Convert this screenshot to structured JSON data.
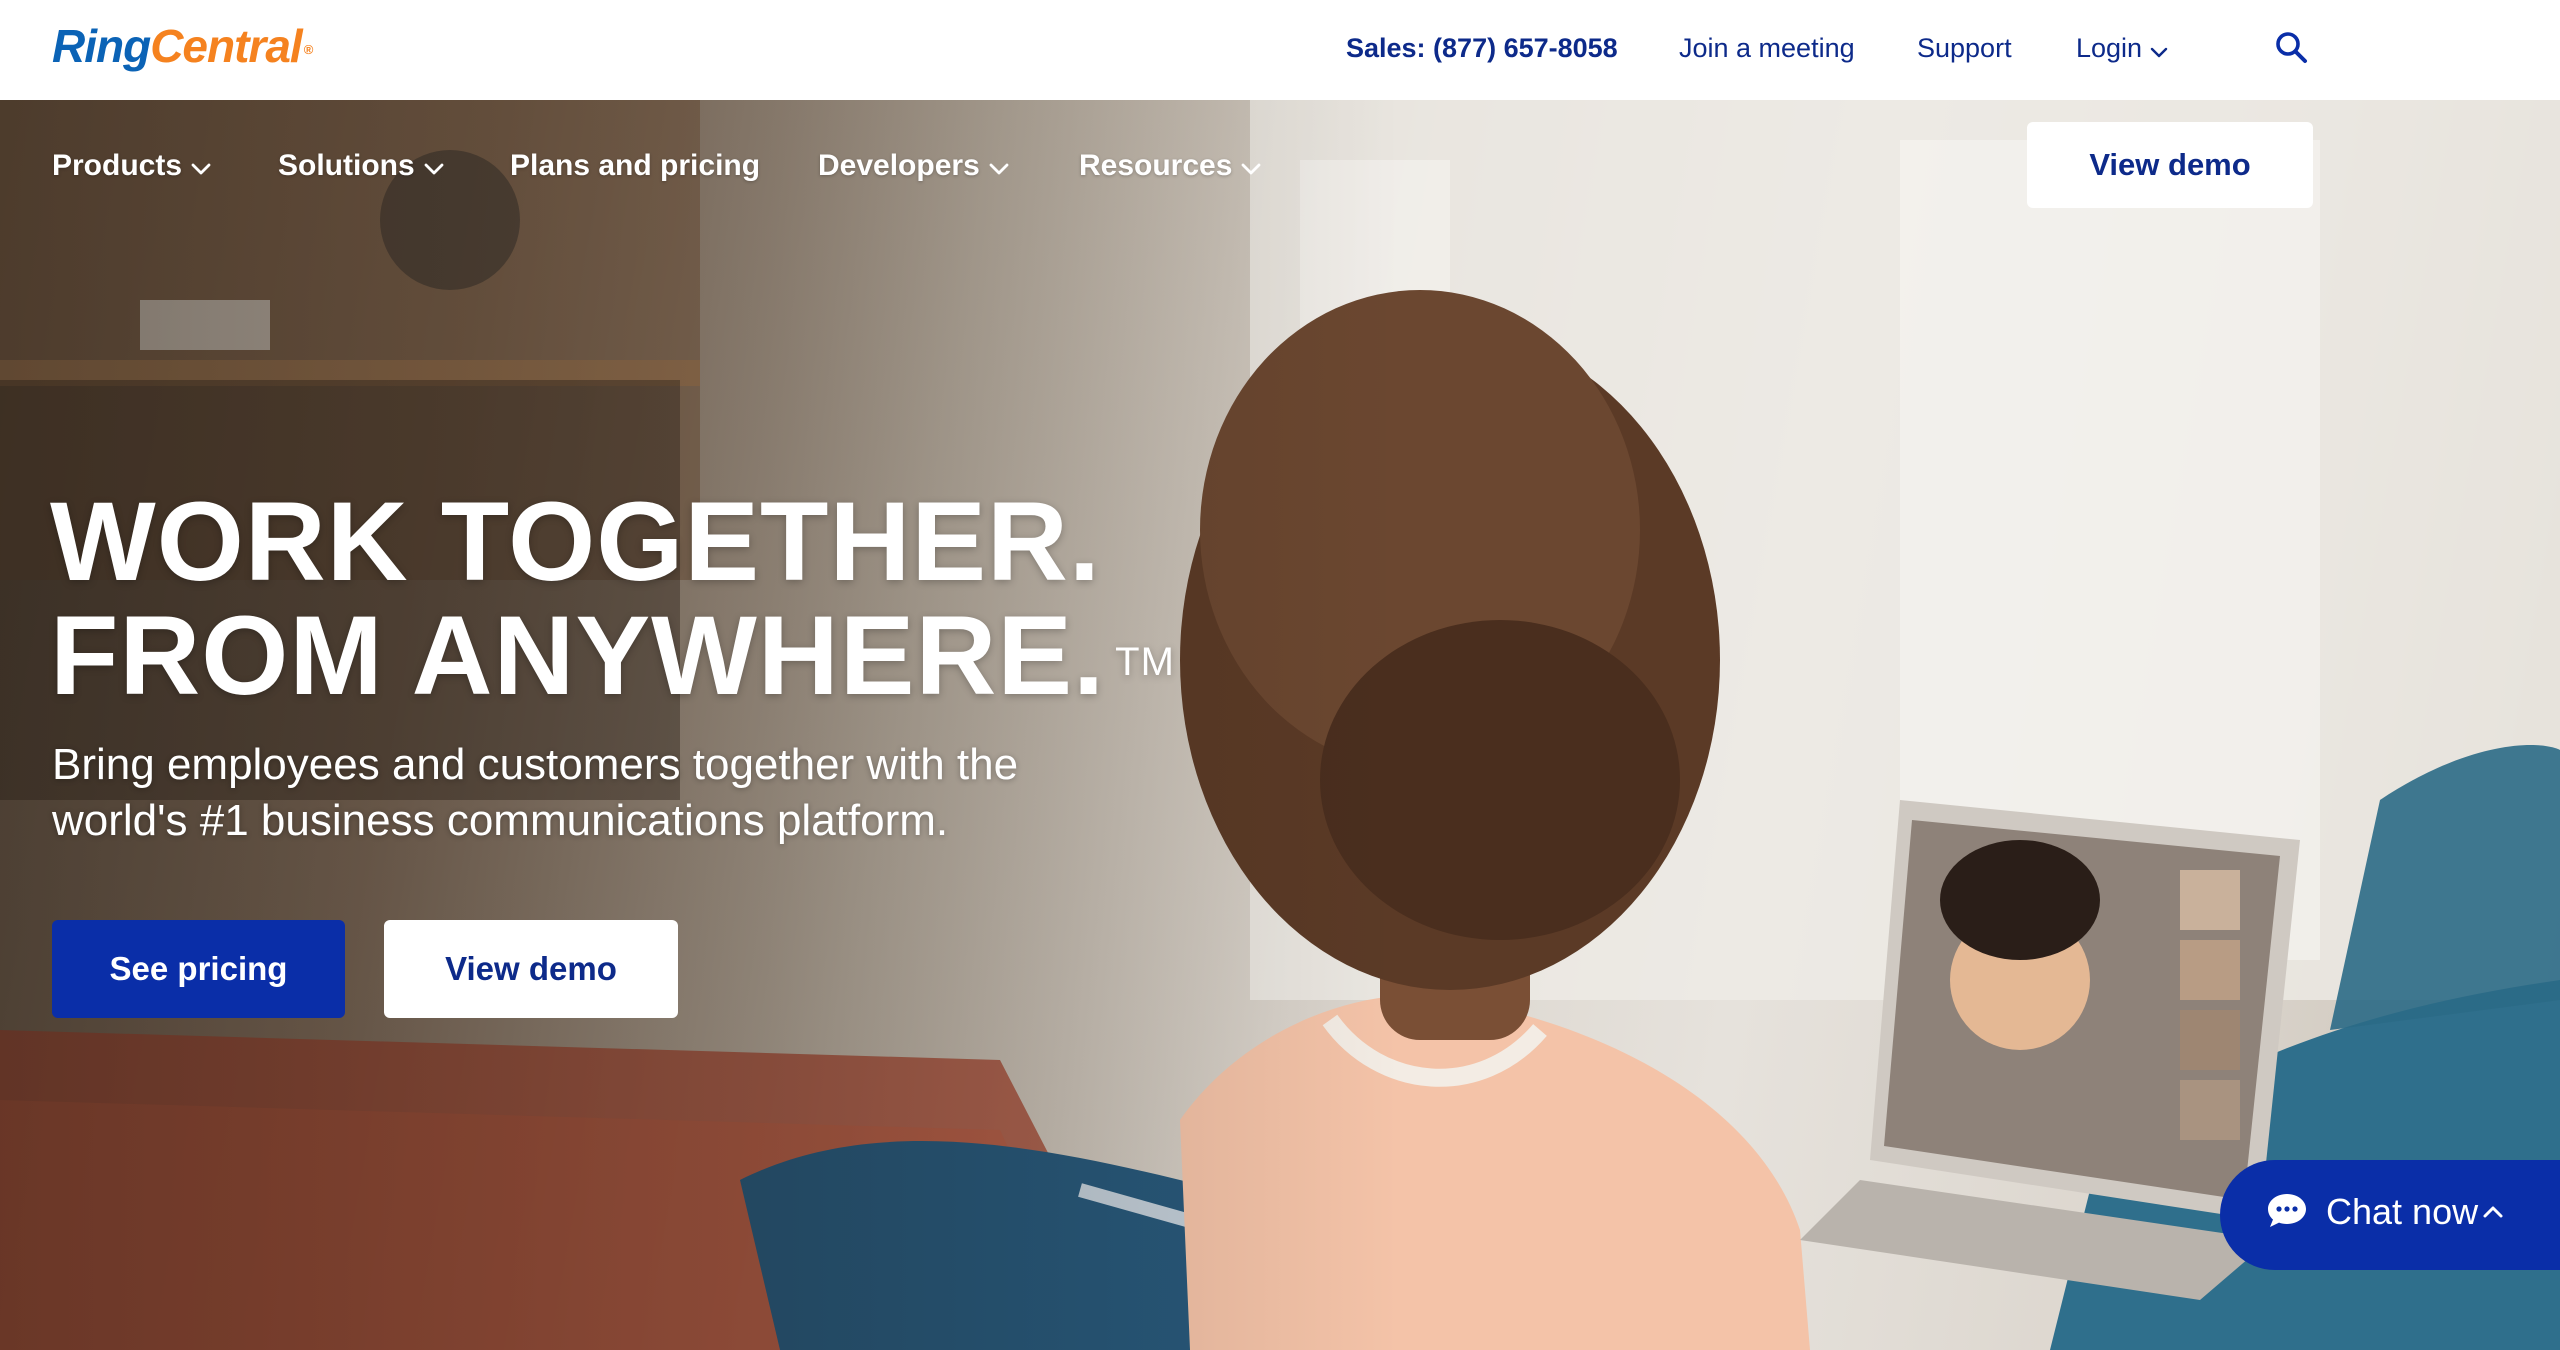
{
  "brand": {
    "logo_part1": "Ring",
    "logo_part2": "Central",
    "logo_registered": "®",
    "colors": {
      "logo_blue": "#0b63b6",
      "logo_orange": "#f5821f",
      "primary_blue": "#0a2ea8",
      "text_navy": "#0d2a8a"
    }
  },
  "utility_nav": {
    "sales": "Sales: (877) 657-8058",
    "join_meeting": "Join a meeting",
    "support": "Support",
    "login": "Login",
    "search_icon": "search-icon"
  },
  "main_nav": {
    "items": [
      {
        "label": "Products",
        "has_dropdown": true
      },
      {
        "label": "Solutions",
        "has_dropdown": true
      },
      {
        "label": "Plans and pricing",
        "has_dropdown": false
      },
      {
        "label": "Developers",
        "has_dropdown": true
      },
      {
        "label": "Resources",
        "has_dropdown": true
      }
    ],
    "cta": "View demo"
  },
  "hero": {
    "title_line1": "WORK TOGETHER.",
    "title_line2": "FROM ANYWHERE.",
    "trademark": "TM",
    "subtitle": "Bring employees and customers together with the world's #1 business communications platform.",
    "primary_cta": "See pricing",
    "secondary_cta": "View demo"
  },
  "chat_widget": {
    "label": "Chat now",
    "icon": "chat-bubble-icon",
    "toggle_icon": "chevron-up-icon"
  }
}
